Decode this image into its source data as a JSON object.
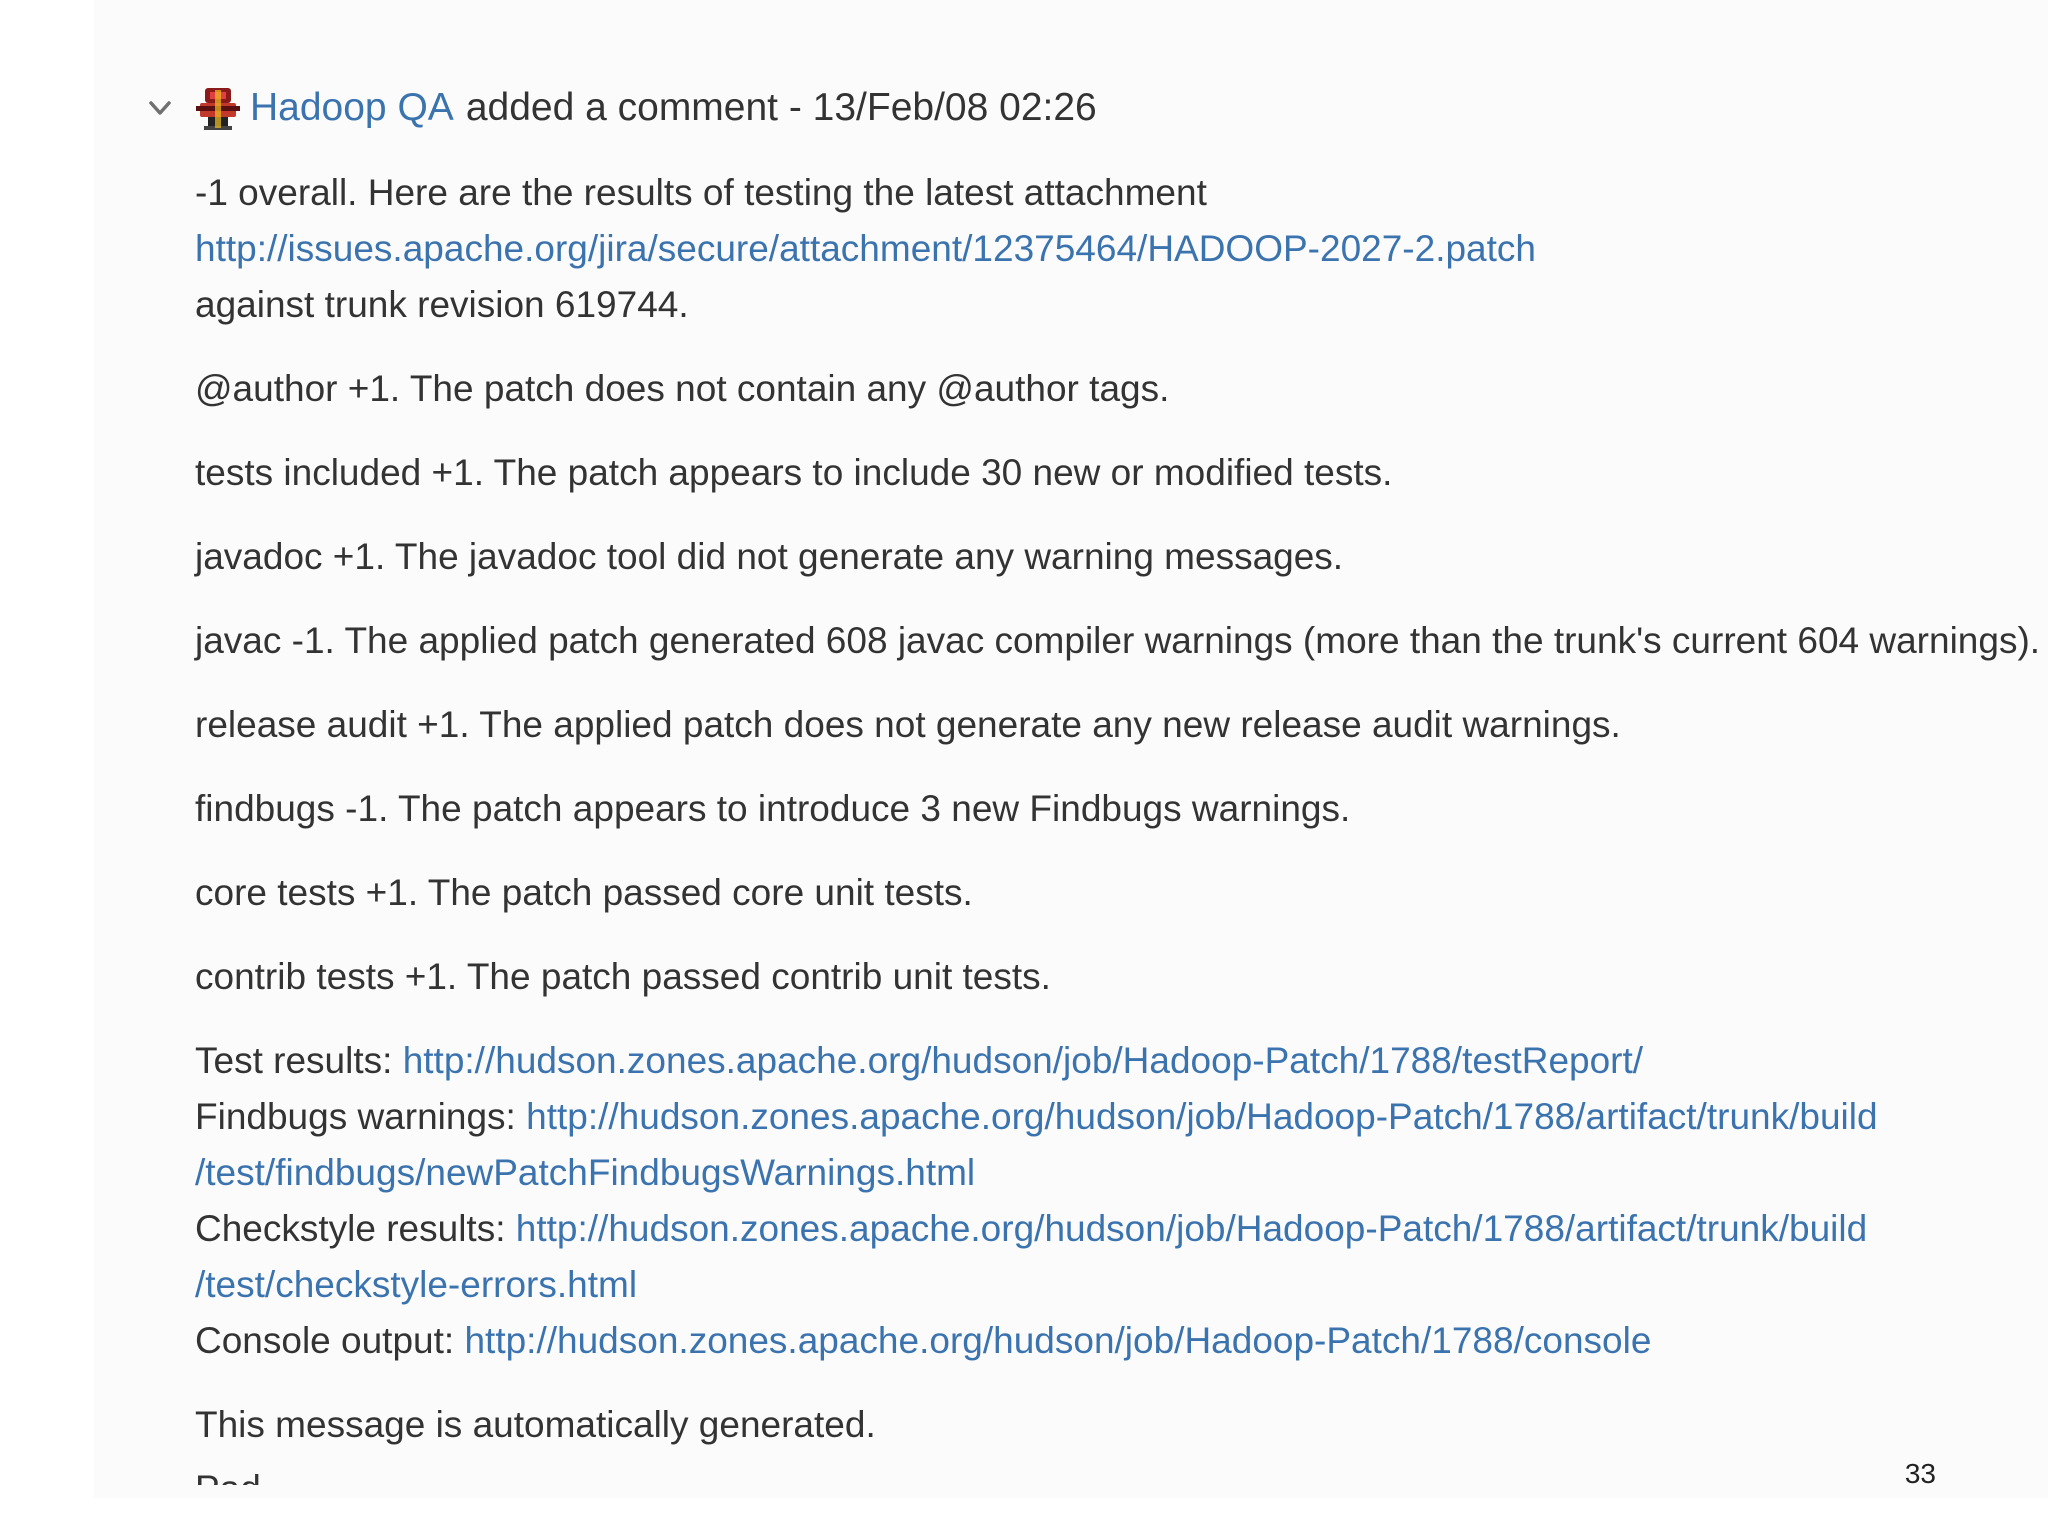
{
  "comment": {
    "author": "Hadoop QA",
    "action": "added a comment -",
    "timestamp": "13/Feb/08 02:26",
    "intro": "-1 overall. Here are the results of testing the latest attachment",
    "attachment_url": "http://issues.apache.org/jira/secure/attachment/12375464/HADOOP-2027-2.patch",
    "against": "against trunk revision 619744.",
    "checks": [
      "@author +1. The patch does not contain any @author tags.",
      "tests included +1. The patch appears to include 30 new or modified tests.",
      "javadoc +1. The javadoc tool did not generate any warning messages.",
      "javac -1. The applied patch generated 608 javac compiler warnings (more than the trunk's current 604 warnings).",
      "release audit +1. The applied patch does not generate any new release audit warnings.",
      "findbugs -1. The patch appears to introduce 3 new Findbugs warnings.",
      "core tests +1. The patch passed core unit tests.",
      "contrib tests +1. The patch passed contrib unit tests."
    ],
    "results": {
      "test_label": "Test results:",
      "test_url": "http://hudson.zones.apache.org/hudson/job/Hadoop-Patch/1788/testReport/",
      "findbugs_label": "Findbugs warnings:",
      "findbugs_url_1": "http://hudson.zones.apache.org/hudson/job/Hadoop-Patch/1788/artifact/trunk/build",
      "findbugs_url_2": "/test/findbugs/newPatchFindbugsWarnings.html",
      "checkstyle_label": "Checkstyle results:",
      "checkstyle_url_1": "http://hudson.zones.apache.org/hudson/job/Hadoop-Patch/1788/artifact/trunk/build",
      "checkstyle_url_2": "/test/checkstyle-errors.html",
      "console_label": "Console output:",
      "console_url": "http://hudson.zones.apache.org/hudson/job/Hadoop-Patch/1788/console"
    },
    "footer": "This message is automatically generated.",
    "cut_off_text": "Pad"
  },
  "slide_number": "33",
  "colors": {
    "link": "#3b73af",
    "text": "#333333",
    "panel_bg": "#fbfbfb"
  },
  "icons": {
    "collapse": "chevron-down-icon",
    "avatar": "hadoop-qa-avatar"
  }
}
